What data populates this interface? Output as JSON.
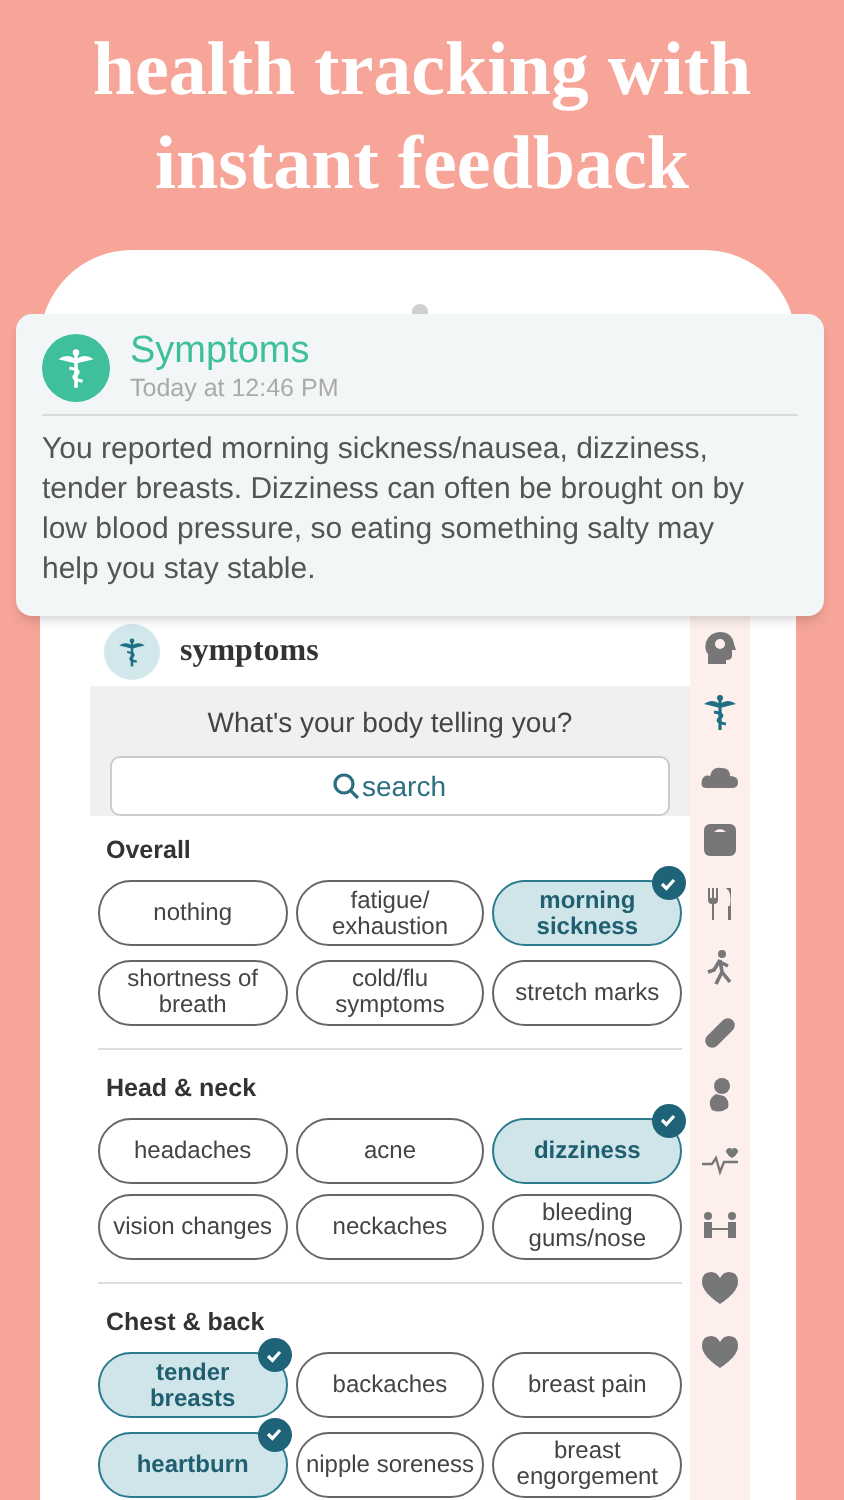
{
  "headline": [
    "health tracking with",
    "instant feedback"
  ],
  "notification": {
    "title": "Symptoms",
    "time": "Today at 12:46 PM",
    "body": "You reported morning sickness/nausea, dizziness, tender breasts. Dizziness can often be brought on by low blood pressure, so eating something salty may help you stay stable."
  },
  "screen": {
    "title": "symptoms",
    "prompt": "What's your body telling you?",
    "search": {
      "placeholder": "search"
    }
  },
  "sections": [
    {
      "title": "Overall",
      "chips": [
        {
          "label": "nothing",
          "selected": false
        },
        {
          "label": "fatigue/ exhaustion",
          "selected": false
        },
        {
          "label": "morning sickness",
          "selected": true
        },
        {
          "label": "shortness of breath",
          "selected": false
        },
        {
          "label": "cold/flu symptoms",
          "selected": false
        },
        {
          "label": "stretch marks",
          "selected": false
        }
      ]
    },
    {
      "title": "Head & neck",
      "chips": [
        {
          "label": "headaches",
          "selected": false
        },
        {
          "label": "acne",
          "selected": false
        },
        {
          "label": "dizziness",
          "selected": true
        },
        {
          "label": "vision changes",
          "selected": false
        },
        {
          "label": "neckaches",
          "selected": false
        },
        {
          "label": "bleeding gums/nose",
          "selected": false
        }
      ]
    },
    {
      "title": "Chest & back",
      "chips": [
        {
          "label": "tender breasts",
          "selected": true
        },
        {
          "label": "backaches",
          "selected": false
        },
        {
          "label": "breast pain",
          "selected": false
        },
        {
          "label": "heartburn",
          "selected": true
        },
        {
          "label": "nipple soreness",
          "selected": false
        },
        {
          "label": "breast engorgement",
          "selected": false
        }
      ]
    }
  ],
  "sidebar": {
    "items": [
      {
        "kind": "head",
        "selected": false
      },
      {
        "kind": "caduceus",
        "selected": true
      },
      {
        "kind": "sleep",
        "selected": false
      },
      {
        "kind": "scale",
        "selected": false
      },
      {
        "kind": "food",
        "selected": false
      },
      {
        "kind": "runner",
        "selected": false
      },
      {
        "kind": "pill",
        "selected": false
      },
      {
        "kind": "baby",
        "selected": false
      },
      {
        "kind": "heartbeat",
        "selected": false
      },
      {
        "kind": "people",
        "selected": false
      },
      {
        "kind": "heart",
        "selected": false
      },
      {
        "kind": "heart",
        "selected": false
      }
    ]
  }
}
